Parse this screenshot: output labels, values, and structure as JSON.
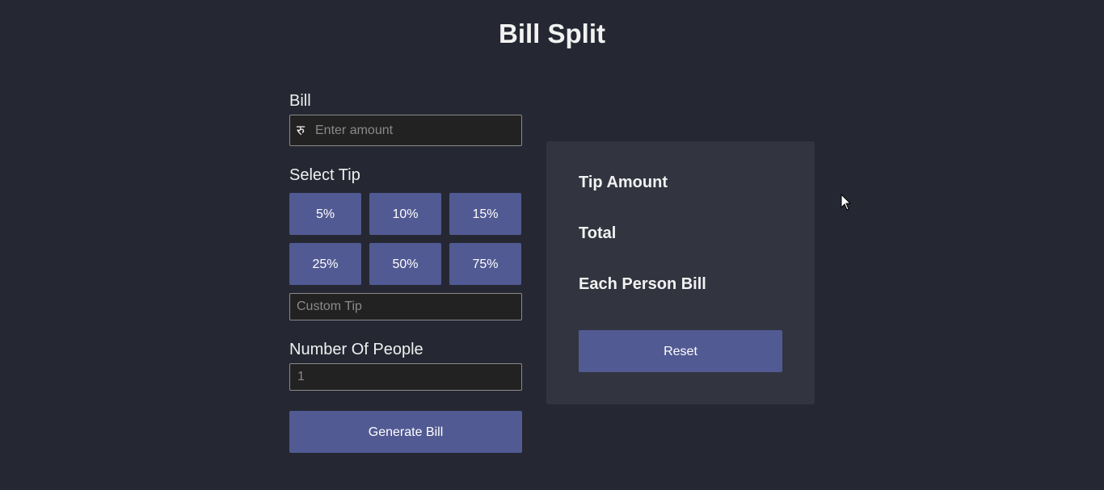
{
  "header": {
    "title": "Bill Split"
  },
  "bill": {
    "label": "Bill",
    "currency_symbol": "रु",
    "placeholder": "Enter amount"
  },
  "tip": {
    "label": "Select Tip",
    "options": [
      "5%",
      "10%",
      "15%",
      "25%",
      "50%",
      "75%"
    ],
    "custom_placeholder": "Custom Tip"
  },
  "people": {
    "label": "Number Of People",
    "placeholder": "1"
  },
  "actions": {
    "generate_label": "Generate Bill",
    "reset_label": "Reset"
  },
  "results": {
    "tip_amount_label": "Tip Amount",
    "total_label": "Total",
    "each_person_label": "Each Person Bill"
  },
  "colors": {
    "background": "#252833",
    "card": "#323540",
    "accent": "#525a93",
    "input_bg": "#222222"
  }
}
